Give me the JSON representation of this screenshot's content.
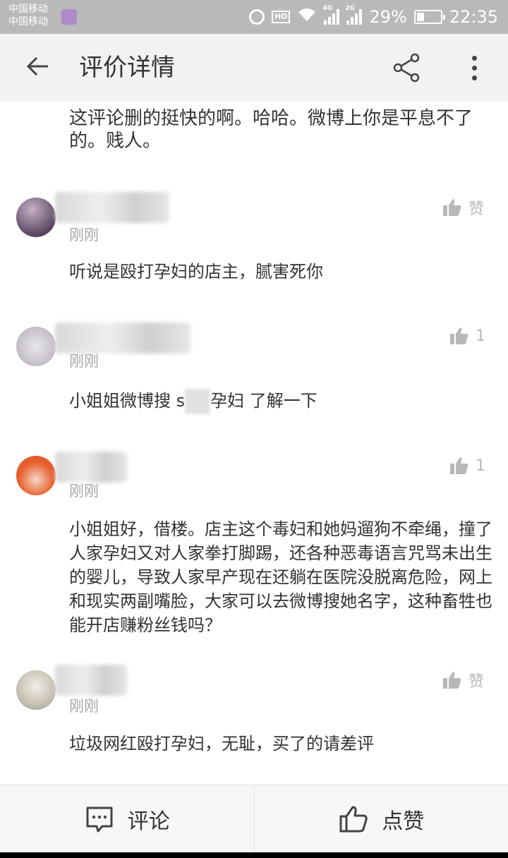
{
  "status_bar": {
    "carrier_1": "中国移动",
    "carrier_2": "中国移动",
    "sim1_tag": "4G",
    "sim2_tag": "2G",
    "battery": "29%",
    "time": "22:35"
  },
  "header": {
    "title": "评价详情",
    "icons": [
      "back-arrow-icon",
      "share-icon",
      "more-vertical-icon"
    ]
  },
  "top_comment": {
    "text": "这评论删的挺快的啊。哈哈。微博上你是平息不了的。贱人。"
  },
  "comments": [
    {
      "time": "刚刚",
      "like_label": "赞",
      "text": "听说是殴打孕妇的店主，腻害死你"
    },
    {
      "time": "刚刚",
      "like_label": "1",
      "text_before": "小姐姐微博搜 s",
      "text_after": "孕妇 了解一下"
    },
    {
      "time": "刚刚",
      "like_label": "1",
      "text": "小姐姐好，借楼。店主这个毒妇和她妈遛狗不牵绳，撞了人家孕妇又对人家拳打脚踢，还各种恶毒语言咒骂未出生的婴儿，导致人家早产现在还躺在医院没脱离危险，网上和现实两副嘴脸，大家可以去微博搜她名字，这种畜牲也能开店赚粉丝钱吗？"
    },
    {
      "time": "刚刚",
      "like_label": "赞",
      "text": "垃圾网红殴打孕妇，无耻，买了的请差评"
    }
  ],
  "bottom_bar": {
    "comment_label": "评论",
    "like_label": "点赞"
  },
  "colors": {
    "status_bar_bg": "#b9b9b9",
    "app_bar_bg": "#f2f2f2",
    "muted_text": "#a8a8a8",
    "like_icon": "#b8b8b8"
  }
}
